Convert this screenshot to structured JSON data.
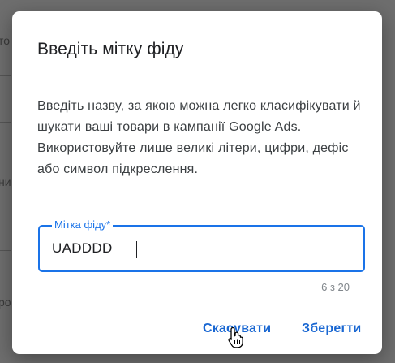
{
  "background": {
    "frag_1": "то",
    "frag_2": "ни",
    "frag_3": "ро"
  },
  "dialog": {
    "title": "Введіть мітку фіду",
    "description": "Введіть назву, за якою можна легко класифікувати й шукати ваші товари в кампанії Google Ads. Використовуйте лише великі літери, цифри, дефіс або символ підкреслення.",
    "field": {
      "label": "Мітка фіду*",
      "value": "UADDDD",
      "counter": "6 з 20"
    },
    "buttons": {
      "cancel": "Скасувати",
      "save": "Зберегти"
    }
  },
  "colors": {
    "accent": "#1a73e8",
    "button_text": "#1967d2",
    "overlay": "#6e6e6e"
  },
  "icons": {
    "pointer": "hand-pointer-icon"
  }
}
